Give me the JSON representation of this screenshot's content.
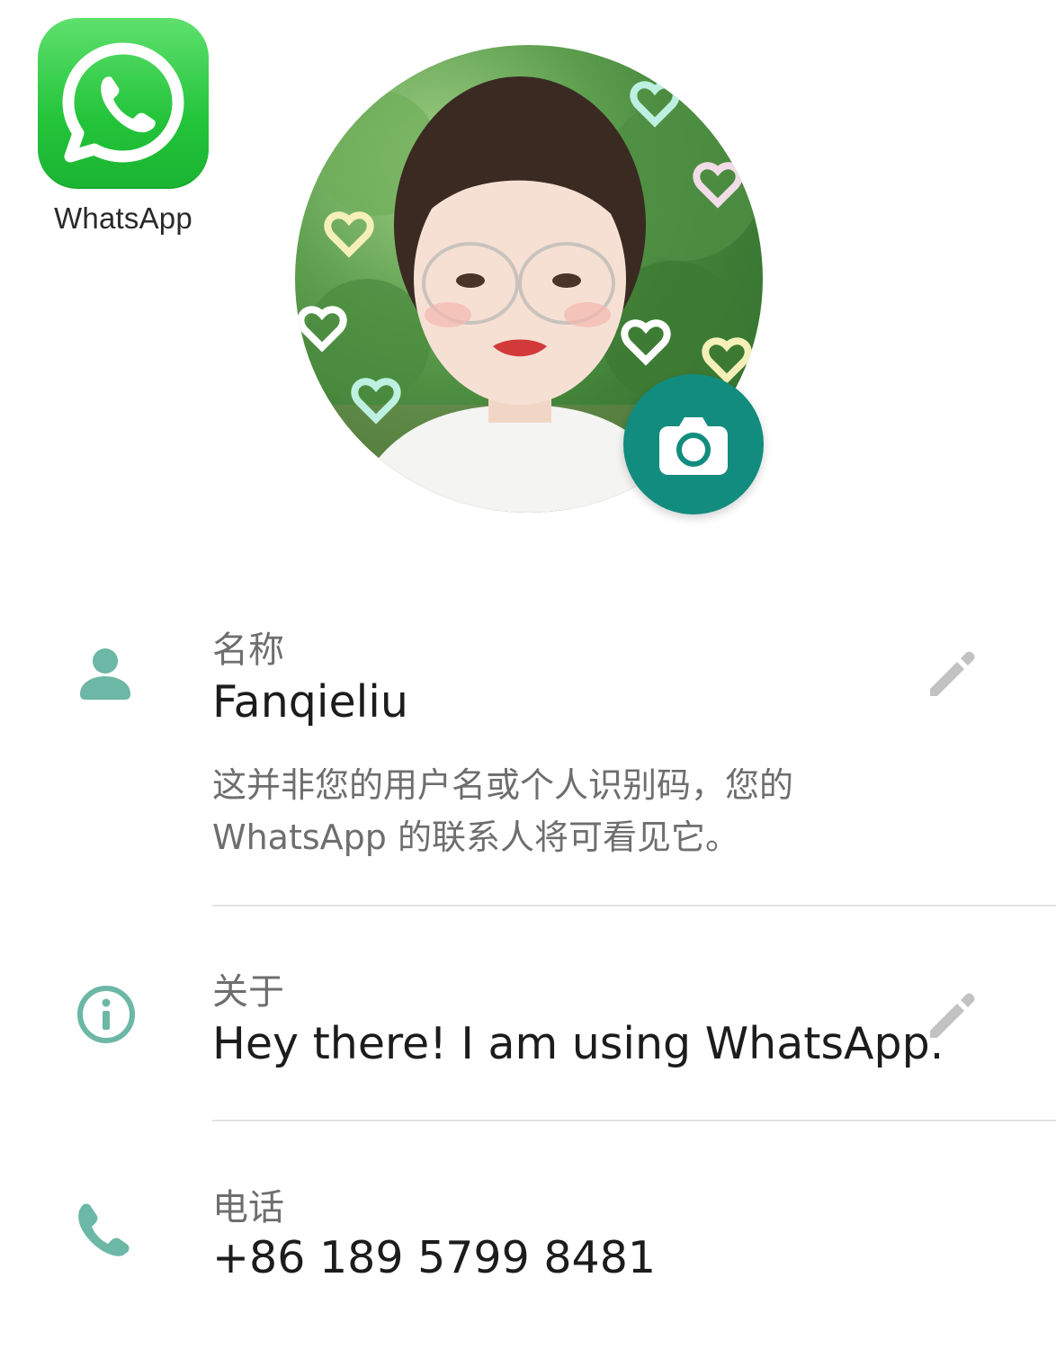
{
  "app": {
    "name": "WhatsApp",
    "icon": "whatsapp-logo"
  },
  "profile": {
    "photo_alt": "Profile photo",
    "camera_icon": "camera-icon"
  },
  "fields": {
    "name": {
      "label": "名称",
      "value": "Fanqieliu",
      "hint": "这并非您的用户名或个人识别码，您的 WhatsApp 的联系人将可看见它。",
      "icon": "person-icon"
    },
    "about": {
      "label": "关于",
      "value": "Hey there! I am using WhatsApp.",
      "icon": "info-icon"
    },
    "phone": {
      "label": "电话",
      "value": "+86 189 5799 8481",
      "icon": "phone-icon"
    }
  },
  "colors": {
    "accent": "#128c7e",
    "icon_teal": "#6cb7a6",
    "edit_gray": "#c2c2c2",
    "brand_green": "#25d366"
  }
}
